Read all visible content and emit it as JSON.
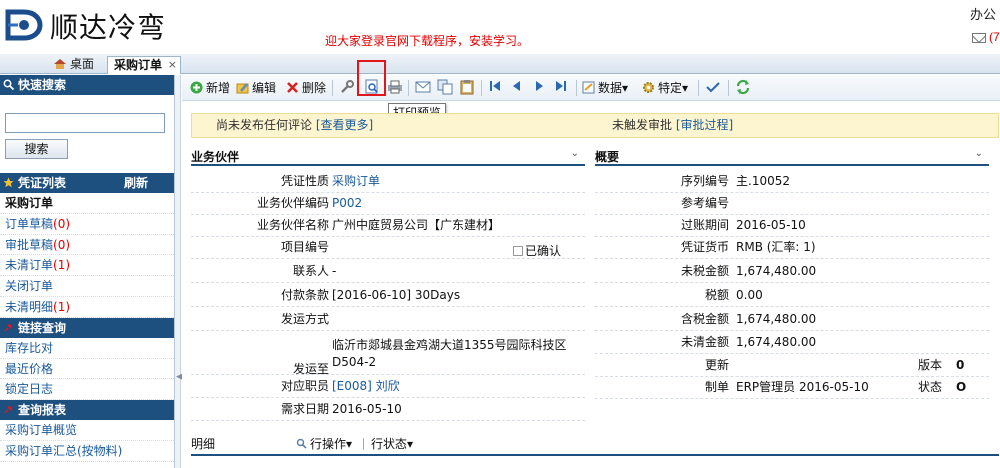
{
  "header": {
    "app_title": "顺达冷弯",
    "notice": "迎大家登录官网下载程序，安装学习。",
    "top_right": "办公",
    "mail_count": "(7"
  },
  "tabs": [
    {
      "label": "桌面"
    },
    {
      "label": "采购订单",
      "close": "×"
    }
  ],
  "sidebar": {
    "quick_search": {
      "title": "快速搜索",
      "button": "搜索",
      "input_value": ""
    },
    "voucher_list": {
      "title": "凭证列表",
      "refresh": "刷新",
      "items": [
        {
          "label": "采购订单",
          "count": ""
        },
        {
          "label": "订单草稿",
          "count": "(0)"
        },
        {
          "label": "审批草稿",
          "count": "(0)"
        },
        {
          "label": "未清订单",
          "count": "(1)"
        },
        {
          "label": "关闭订单",
          "count": ""
        },
        {
          "label": "未清明细",
          "count": "(1)"
        }
      ]
    },
    "link_query": {
      "title": "链接查询",
      "items": [
        "库存比对",
        "最近价格",
        "锁定日志"
      ]
    },
    "report_query": {
      "title": "查询报表",
      "items": [
        "采购订单概览",
        "采购订单汇总(按物料)"
      ]
    }
  },
  "toolbar": {
    "new": "新增",
    "edit": "编辑",
    "delete": "删除",
    "data": "数据",
    "special": "特定",
    "tooltip": "打印预览"
  },
  "infobar": {
    "left_text": "尚未发布任何评论",
    "left_link": "[查看更多]",
    "right_text": "未触发审批",
    "right_link": "[审批过程]"
  },
  "partner": {
    "title": "业务伙伴",
    "fields": [
      {
        "label": "凭证性质",
        "value": "采购订单",
        "link": true
      },
      {
        "label": "业务伙伴编码",
        "value": "P002",
        "link": true
      },
      {
        "label": "业务伙伴名称",
        "value": "广州中庭贸易公司【广东建材】",
        "link": false
      },
      {
        "label": "项目编号",
        "value": "",
        "link": false
      },
      {
        "label": "联系人",
        "value": "-",
        "link": false
      },
      {
        "label": "付款条款",
        "value": "[2016-06-10] 30Days",
        "link": false
      },
      {
        "label": "发运方式",
        "value": "",
        "link": false
      },
      {
        "label": "发运至",
        "value_line1": "临沂市郯城县金鸡湖大道1355号园际科技区",
        "value_line2": "D504-2"
      },
      {
        "label": "对应职员",
        "value": "[E008] 刘欣",
        "link": true
      },
      {
        "label": "需求日期",
        "value": "2016-05-10",
        "link": false
      }
    ],
    "confirmed_label": "已确认"
  },
  "summary": {
    "title": "概要",
    "fields": [
      {
        "label": "序列编号",
        "value": "主.10052"
      },
      {
        "label": "参考编号",
        "value": ""
      },
      {
        "label": "过账期间",
        "value": "2016-05-10"
      },
      {
        "label": "凭证货币",
        "value": "RMB (汇率: 1)"
      },
      {
        "label": "未税金额",
        "value": "1,674,480.00"
      },
      {
        "label": "税额",
        "value": "0.00"
      },
      {
        "label": "含税金额",
        "value": "1,674,480.00"
      },
      {
        "label": "未清金额",
        "value": "1,674,480.00"
      },
      {
        "label": "更新",
        "value": ""
      },
      {
        "label": "制单",
        "value": "ERP管理员 2016-05-10"
      }
    ],
    "version_label": "版本",
    "version_value": "0",
    "status_label": "状态",
    "status_value": "O"
  },
  "detail": {
    "title": "明细",
    "row_ops": "行操作",
    "row_status": "行状态"
  },
  "colors": {
    "nav_header": "#1d4f7f",
    "link": "#1a5a9a",
    "alert_red": "#e0161b",
    "notice_bg": "#fdf5cf"
  }
}
